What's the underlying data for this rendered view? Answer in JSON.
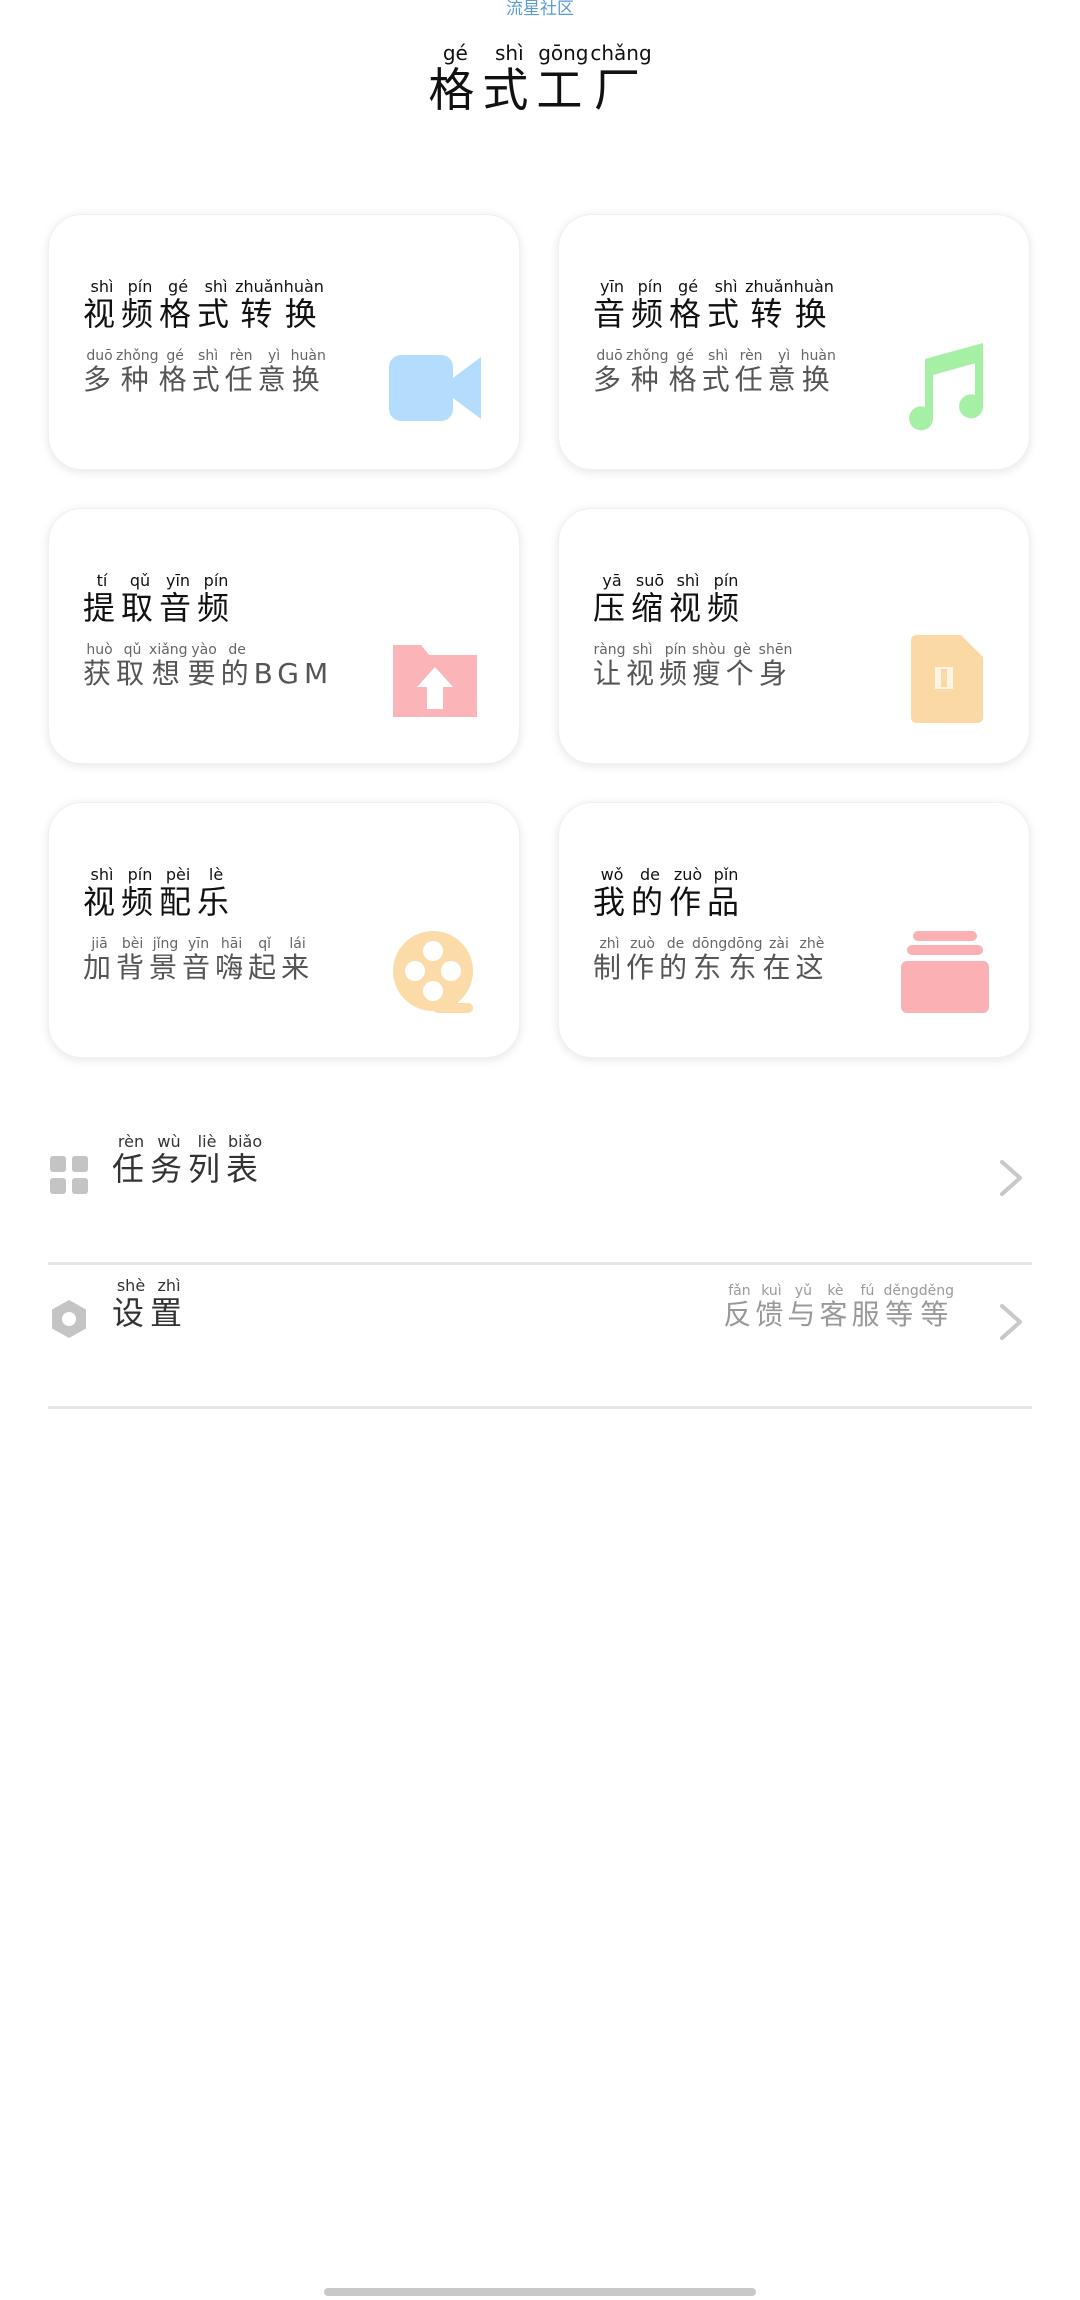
{
  "top_link": "流星社区",
  "page_title": [
    {
      "c": "格",
      "p": "gé"
    },
    {
      "c": "式",
      "p": "shì"
    },
    {
      "c": "工",
      "p": "gōng"
    },
    {
      "c": "厂",
      "p": "chǎng"
    }
  ],
  "cards": [
    {
      "title": [
        {
          "c": "视",
          "p": "shì"
        },
        {
          "c": "频",
          "p": "pín"
        },
        {
          "c": "格",
          "p": "gé"
        },
        {
          "c": "式",
          "p": "shì"
        },
        {
          "c": "转",
          "p": "zhuǎn"
        },
        {
          "c": "换",
          "p": "huàn"
        }
      ],
      "subtitle": [
        {
          "c": "多",
          "p": "duō"
        },
        {
          "c": "种",
          "p": "zhǒng"
        },
        {
          "c": "格",
          "p": "gé"
        },
        {
          "c": "式",
          "p": "shì"
        },
        {
          "c": "任",
          "p": "rèn"
        },
        {
          "c": "意",
          "p": "yì"
        },
        {
          "c": "换",
          "p": "huàn"
        }
      ],
      "icon": "video-camera-icon",
      "color": "#b3dcfd"
    },
    {
      "title": [
        {
          "c": "音",
          "p": "yīn"
        },
        {
          "c": "频",
          "p": "pín"
        },
        {
          "c": "格",
          "p": "gé"
        },
        {
          "c": "式",
          "p": "shì"
        },
        {
          "c": "转",
          "p": "zhuǎn"
        },
        {
          "c": "换",
          "p": "huàn"
        }
      ],
      "subtitle": [
        {
          "c": "多",
          "p": "duō"
        },
        {
          "c": "种",
          "p": "zhǒng"
        },
        {
          "c": "格",
          "p": "gé"
        },
        {
          "c": "式",
          "p": "shì"
        },
        {
          "c": "任",
          "p": "rèn"
        },
        {
          "c": "意",
          "p": "yì"
        },
        {
          "c": "换",
          "p": "huàn"
        }
      ],
      "icon": "music-note-icon",
      "color": "#a6f0a6"
    },
    {
      "title": [
        {
          "c": "提",
          "p": "tí"
        },
        {
          "c": "取",
          "p": "qǔ"
        },
        {
          "c": "音",
          "p": "yīn"
        },
        {
          "c": "频",
          "p": "pín"
        }
      ],
      "subtitle": [
        {
          "c": "获",
          "p": "huò"
        },
        {
          "c": "取",
          "p": "qǔ"
        },
        {
          "c": "想",
          "p": "xiǎng"
        },
        {
          "c": "要",
          "p": "yào"
        },
        {
          "c": "的",
          "p": "de"
        },
        {
          "c": "BGM",
          "p": ""
        }
      ],
      "icon": "folder-upload-icon",
      "color": "#fbb4b8"
    },
    {
      "title": [
        {
          "c": "压",
          "p": "yā"
        },
        {
          "c": "缩",
          "p": "suō"
        },
        {
          "c": "视",
          "p": "shì"
        },
        {
          "c": "频",
          "p": "pín"
        }
      ],
      "subtitle": [
        {
          "c": "让",
          "p": "ràng"
        },
        {
          "c": "视",
          "p": "shì"
        },
        {
          "c": "频",
          "p": "pín"
        },
        {
          "c": "瘦",
          "p": "shòu"
        },
        {
          "c": "个",
          "p": "gè"
        },
        {
          "c": "身",
          "p": "shēn"
        }
      ],
      "icon": "zip-file-icon",
      "color": "#fbd9a4"
    },
    {
      "title": [
        {
          "c": "视",
          "p": "shì"
        },
        {
          "c": "频",
          "p": "pín"
        },
        {
          "c": "配",
          "p": "pèi"
        },
        {
          "c": "乐",
          "p": "lè"
        }
      ],
      "subtitle": [
        {
          "c": "加",
          "p": "jiā"
        },
        {
          "c": "背",
          "p": "bèi"
        },
        {
          "c": "景",
          "p": "jǐng"
        },
        {
          "c": "音",
          "p": "yīn"
        },
        {
          "c": "嗨",
          "p": "hāi"
        },
        {
          "c": "起",
          "p": "qǐ"
        },
        {
          "c": "来",
          "p": "lái"
        }
      ],
      "icon": "film-reel-icon",
      "color": "#fbdba8"
    },
    {
      "title": [
        {
          "c": "我",
          "p": "wǒ"
        },
        {
          "c": "的",
          "p": "de"
        },
        {
          "c": "作",
          "p": "zuò"
        },
        {
          "c": "品",
          "p": "pǐn"
        }
      ],
      "subtitle": [
        {
          "c": "制",
          "p": "zhì"
        },
        {
          "c": "作",
          "p": "zuò"
        },
        {
          "c": "的",
          "p": "de"
        },
        {
          "c": "东",
          "p": "dōng"
        },
        {
          "c": "东",
          "p": "dōng"
        },
        {
          "c": "在",
          "p": "zài"
        },
        {
          "c": "这",
          "p": "zhè"
        }
      ],
      "icon": "stacked-layers-icon",
      "color": "#fbb0b4"
    }
  ],
  "list": [
    {
      "label": [
        {
          "c": "任",
          "p": "rèn"
        },
        {
          "c": "务",
          "p": "wù"
        },
        {
          "c": "列",
          "p": "liè"
        },
        {
          "c": "表",
          "p": "biǎo"
        }
      ],
      "hint": [],
      "icon": "grid-icon"
    },
    {
      "label": [
        {
          "c": "设",
          "p": "shè"
        },
        {
          "c": "置",
          "p": "zhì"
        }
      ],
      "hint": [
        {
          "c": "反",
          "p": "fǎn"
        },
        {
          "c": "馈",
          "p": "kuì"
        },
        {
          "c": "与",
          "p": "yǔ"
        },
        {
          "c": "客",
          "p": "kè"
        },
        {
          "c": "服",
          "p": "fú"
        },
        {
          "c": "等",
          "p": "děng"
        },
        {
          "c": "等",
          "p": "děng"
        }
      ],
      "icon": "settings-hexagon-icon"
    }
  ],
  "icon_gray": "#c4c4c4"
}
